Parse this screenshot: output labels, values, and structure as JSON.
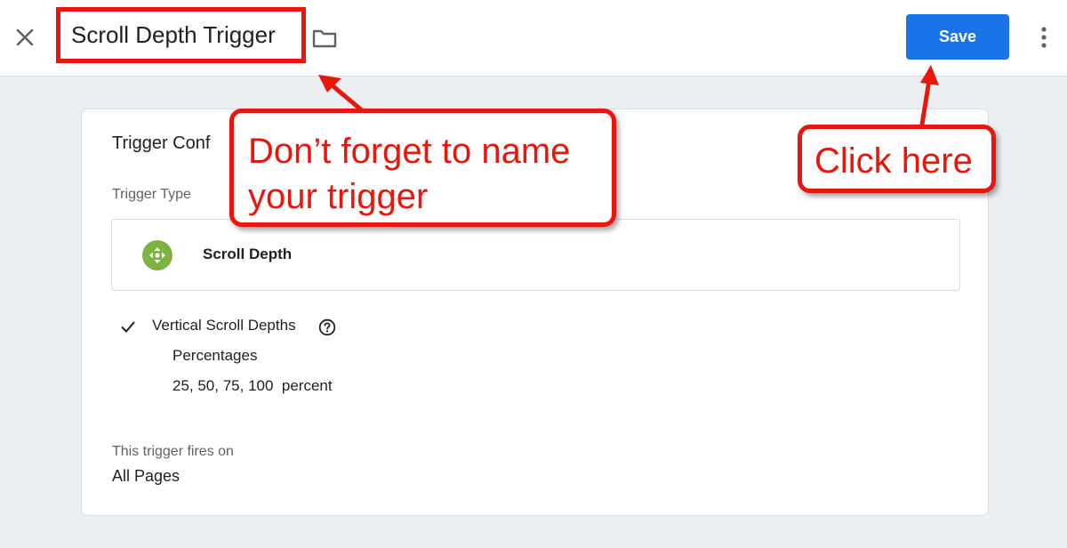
{
  "header": {
    "title": "Scroll Depth Trigger",
    "save_label": "Save"
  },
  "card": {
    "title": "Trigger Conf",
    "trigger_type_label": "Trigger Type",
    "trigger_type_name": "Scroll Depth",
    "vertical_label": "Vertical Scroll Depths",
    "percentages_label": "Percentages",
    "percentages_value": "25, 50, 75, 100  percent",
    "fires_on_label": "This trigger fires on",
    "fires_on_value": "All Pages"
  },
  "annotations": {
    "name_line1": "Don’t forget to name",
    "name_line2": "your trigger",
    "save_hint": "Click here"
  },
  "colors": {
    "accent": "#1a73e8",
    "annotation_red": "#e8160c",
    "trigger_icon_green": "#7cb342"
  },
  "icons": {
    "close": "close-icon",
    "folder": "folder-icon",
    "more": "more-vert-icon",
    "trigger_type": "scroll-move-icon",
    "check": "check-icon",
    "help": "help-circle-icon"
  }
}
